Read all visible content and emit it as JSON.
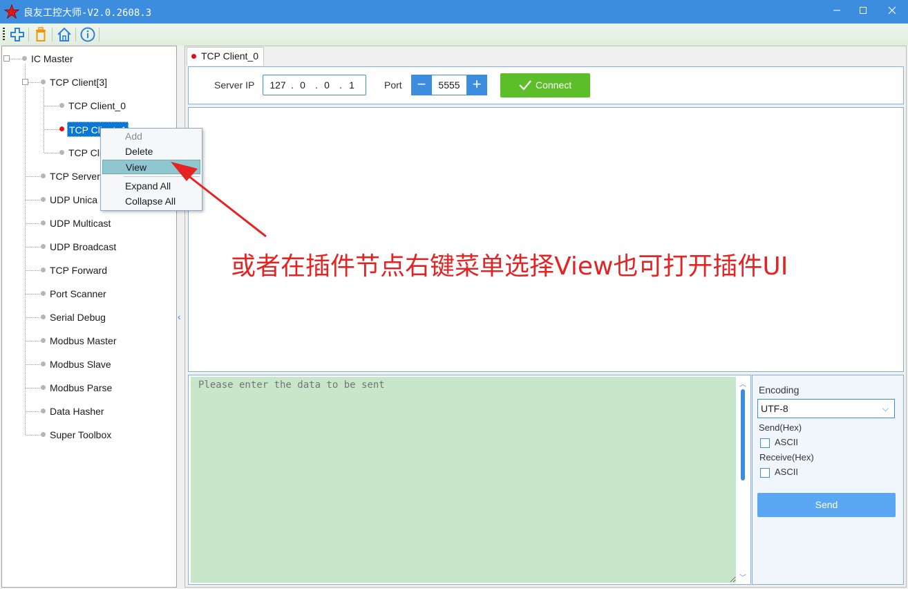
{
  "window": {
    "title": "良友工控大师-V2.0.2608.3",
    "minimize": "—",
    "maximize": "☐",
    "close": "✕"
  },
  "toolbar": {
    "icons": [
      "add-icon",
      "delete-icon",
      "home-icon",
      "info-icon"
    ]
  },
  "tree": {
    "root": "IC Master",
    "tcp_client_group": "TCP Client[3]",
    "clients": [
      "TCP Client_0",
      "TCP Client_1",
      "TCP Client_2"
    ],
    "client_visible": [
      "TCP Client_0",
      "TCP Client_1",
      "TCP Cli"
    ],
    "items": [
      "TCP Server",
      "UDP Unicast",
      "UDP Multicast",
      "UDP Broadcast",
      "TCP Forward",
      "Port Scanner",
      "Serial Debug",
      "Modbus Master",
      "Modbus Slave",
      "Modbus Parse",
      "Data Hasher",
      "Super Toolbox"
    ],
    "items_visible": [
      "TCP Server",
      "UDP Unica",
      "UDP Multicast",
      "UDP Broadcast",
      "TCP Forward",
      "Port Scanner",
      "Serial Debug",
      "Modbus Master",
      "Modbus Slave",
      "Modbus Parse",
      "Data Hasher",
      "Super Toolbox"
    ]
  },
  "context_menu": {
    "items": [
      "Add",
      "Delete",
      "View",
      "Expand All",
      "Collapse All"
    ],
    "disabled": "Add",
    "highlighted": "View"
  },
  "tab": {
    "label": "TCP Client_0"
  },
  "connection": {
    "server_ip_label": "Server IP",
    "ip": [
      "127",
      "0",
      "0",
      "1"
    ],
    "port_label": "Port",
    "port": "5555",
    "minus": "−",
    "plus": "+",
    "connect_label": "Connect"
  },
  "send": {
    "placeholder": "Please enter the data to be sent"
  },
  "options": {
    "encoding_label": "Encoding",
    "encoding_value": "UTF-8",
    "send_hex_label": "Send(Hex)",
    "send_ascii_label": "ASCII",
    "receive_hex_label": "Receive(Hex)",
    "receive_ascii_label": "ASCII",
    "send_button": "Send"
  },
  "annotation": {
    "text": "或者在插件节点右键菜单选择View也可打开插件UI",
    "color": "#e42323"
  },
  "colors": {
    "accent": "#3c8dde",
    "connect": "#5cbf2a",
    "send_bg": "#c8e6c9",
    "selection": "#0a76d6"
  }
}
